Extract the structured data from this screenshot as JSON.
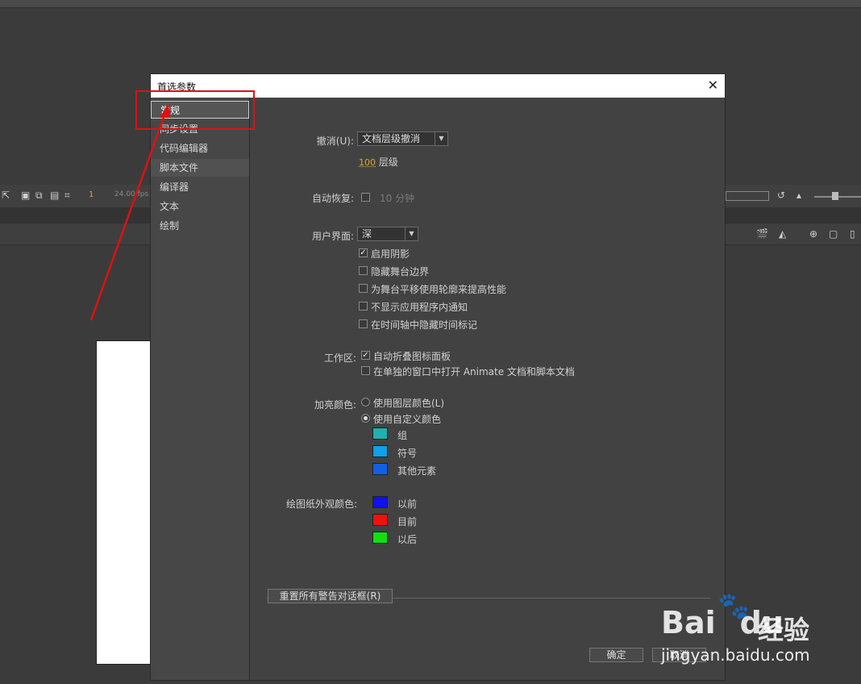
{
  "dialog": {
    "title": "首选参数",
    "close_icon": "close-icon"
  },
  "background": {
    "frame_number": "1",
    "fps": "24.00 fps"
  },
  "sidebar": {
    "items": [
      {
        "label": "常规"
      },
      {
        "label": "同步设置"
      },
      {
        "label": "代码编辑器"
      },
      {
        "label": "脚本文件"
      },
      {
        "label": "编译器"
      },
      {
        "label": "文本"
      },
      {
        "label": "绘制"
      }
    ]
  },
  "undo": {
    "label": "撤消(U):",
    "selected": "文档层级撤消",
    "levels_value": "100",
    "levels_unit": "层级"
  },
  "autorecover": {
    "label": "自动恢复:",
    "minutes_value": "10",
    "minutes_unit": "分钟"
  },
  "ui": {
    "label": "用户界面:",
    "selected": "深",
    "options": [
      {
        "label": "启用阴影",
        "checked": true
      },
      {
        "label": "隐藏舞台边界",
        "checked": false
      },
      {
        "label": "为舞台平移使用轮廓来提高性能",
        "checked": false
      },
      {
        "label": "不显示应用程序内通知",
        "checked": false
      },
      {
        "label": "在时间轴中隐藏时间标记",
        "checked": false
      }
    ]
  },
  "workspace": {
    "label": "工作区:",
    "options": [
      {
        "label": "自动折叠图标面板",
        "checked": true
      },
      {
        "label": "在单独的窗口中打开 Animate 文档和脚本文档",
        "checked": false
      }
    ]
  },
  "highlight": {
    "label": "加亮颜色:",
    "radios": [
      {
        "label": "使用图层颜色(L)",
        "selected": false
      },
      {
        "label": "使用自定义颜色",
        "selected": true
      }
    ],
    "swatches": [
      {
        "label": "组",
        "color": "#20b0b0"
      },
      {
        "label": "符号",
        "color": "#10a0e8"
      },
      {
        "label": "其他元素",
        "color": "#1060e8"
      }
    ]
  },
  "onion": {
    "label": "绘图纸外观颜色:",
    "swatches": [
      {
        "label": "以前",
        "color": "#1010f0"
      },
      {
        "label": "目前",
        "color": "#f01010"
      },
      {
        "label": "以后",
        "color": "#10e010"
      }
    ]
  },
  "buttons": {
    "reset": "重置所有警告对话框(R)",
    "ok": "确定",
    "cancel": "取消"
  },
  "watermark": {
    "brand": "Bai",
    "brand2": "du",
    "cn": "经验",
    "url": "jingyan.baidu.com"
  }
}
